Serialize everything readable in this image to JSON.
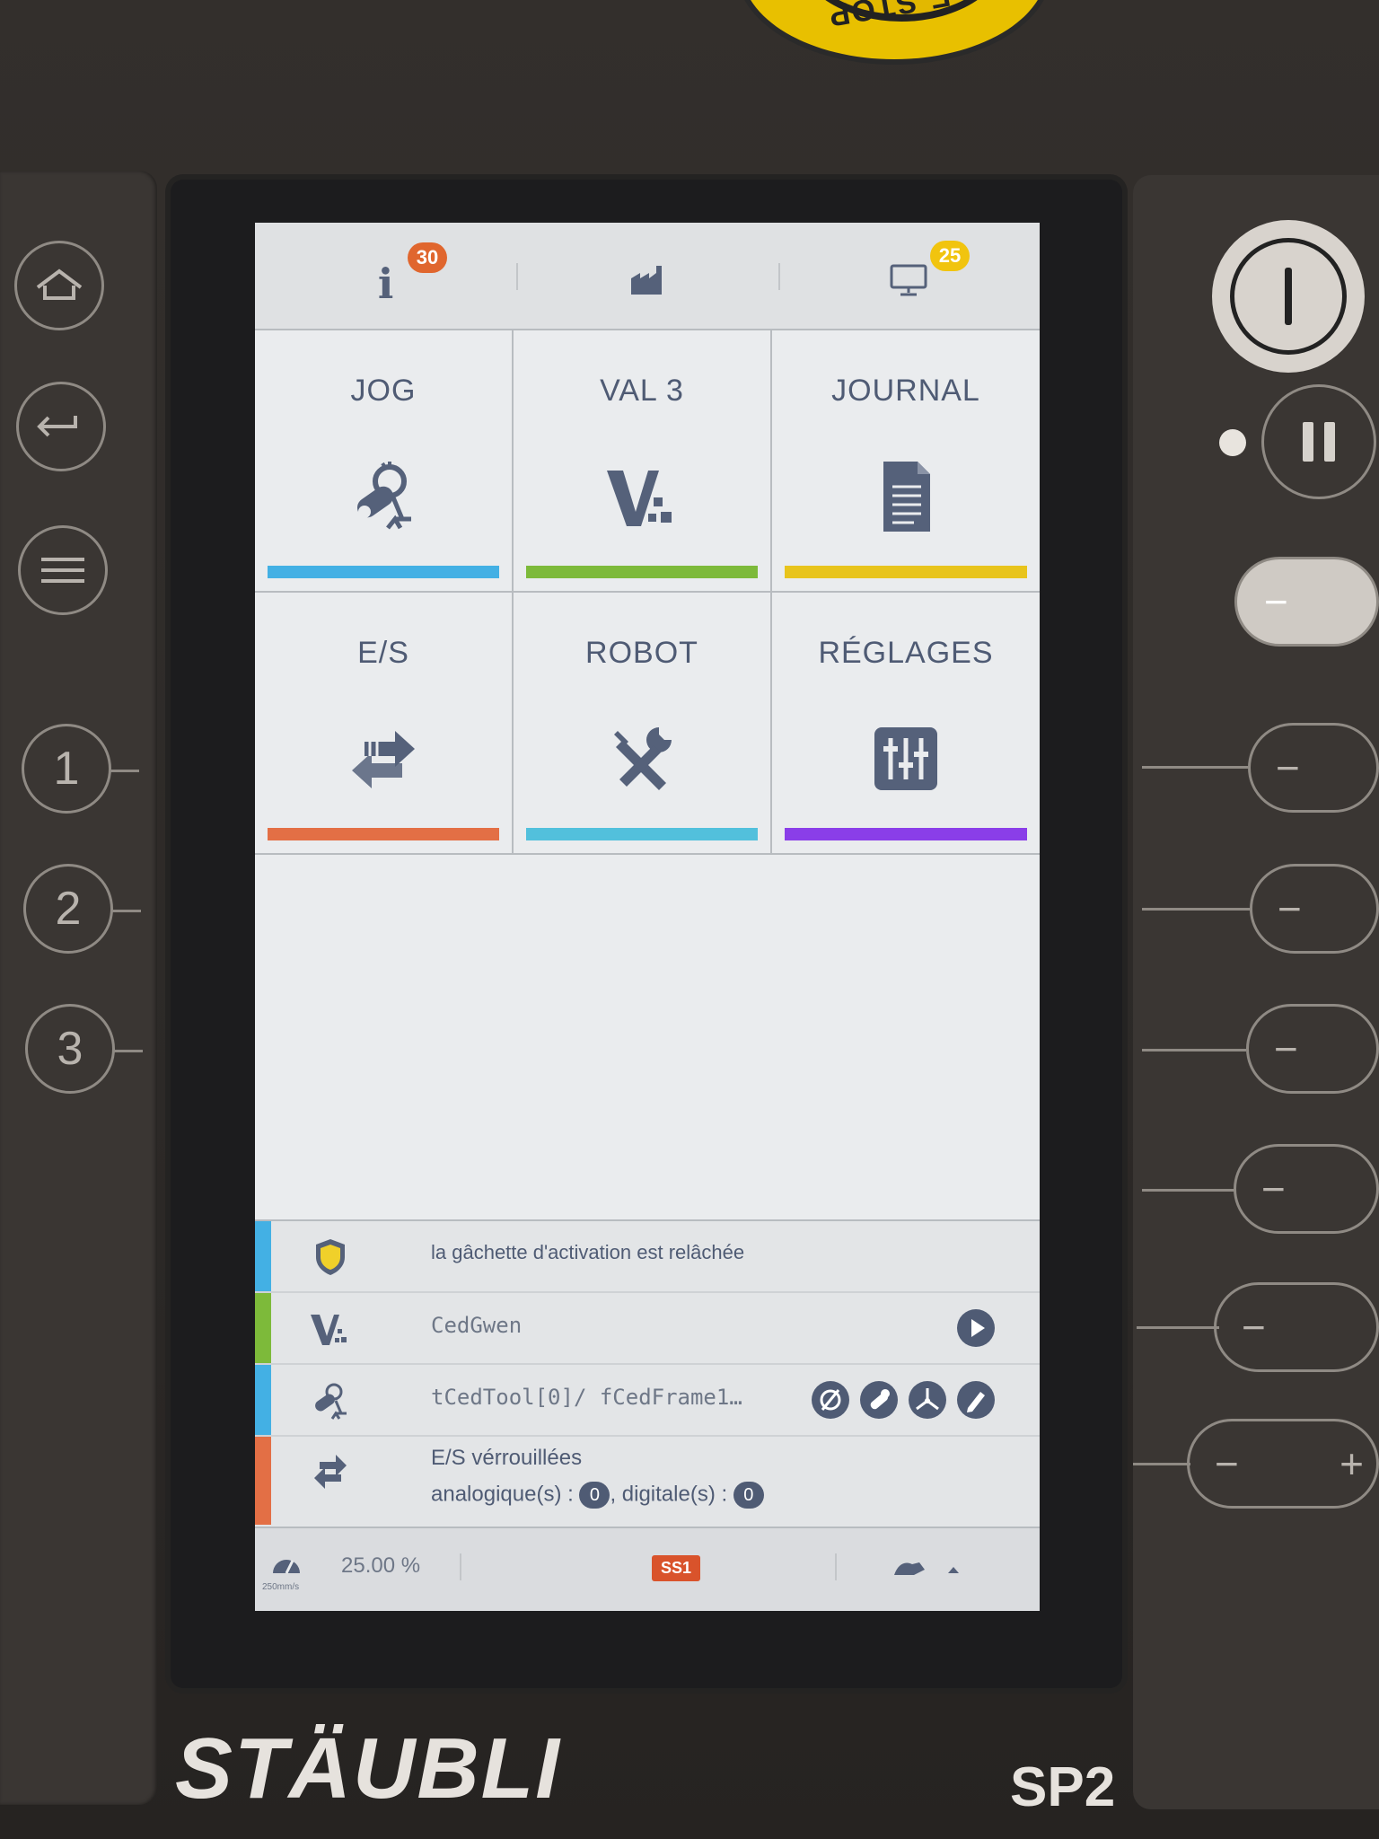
{
  "hardware": {
    "estop_label": "E-STOP",
    "brand": "STÄUBLI",
    "model": "SP2",
    "numbered_buttons": [
      "1",
      "2",
      "3"
    ],
    "power_symbol": "I"
  },
  "topbar": {
    "info_badge": "30",
    "monitor_badge": "25",
    "icons": [
      "info-icon",
      "factory-icon",
      "monitor-icon"
    ]
  },
  "tiles": [
    {
      "label": "JOG",
      "icon": "robot-arm-icon",
      "color": "#43b0e4"
    },
    {
      "label": "VAL 3",
      "icon": "val3-logo-icon",
      "color": "#7dba3a"
    },
    {
      "label": "JOURNAL",
      "icon": "document-icon",
      "color": "#e8c41c"
    },
    {
      "label": "E/S",
      "icon": "transfer-arrows-icon",
      "color": "#e36f45"
    },
    {
      "label": "ROBOT",
      "icon": "tools-icon",
      "color": "#52c0dc"
    },
    {
      "label": "RÉGLAGES",
      "icon": "sliders-icon",
      "color": "#8a3ee8"
    }
  ],
  "status": {
    "trigger_text": "la gâchette d'activation est relâchée",
    "app_name": "CedGwen",
    "tool_frame": "tCedTool[0]/ fCedFrame1…",
    "io_title": "E/S vérrouillées",
    "io_analog_label": "analogique(s) :",
    "io_analog_value": "0",
    "io_digital_label": ", digitale(s) :",
    "io_digital_value": "0",
    "strip_colors": [
      "#43b0e4",
      "#7dba3a",
      "#43b0e4",
      "#e36f45"
    ]
  },
  "bottombar": {
    "speed_percent": "25.00 %",
    "speed_limit": "250mm/s",
    "safety_state": "SS1"
  }
}
